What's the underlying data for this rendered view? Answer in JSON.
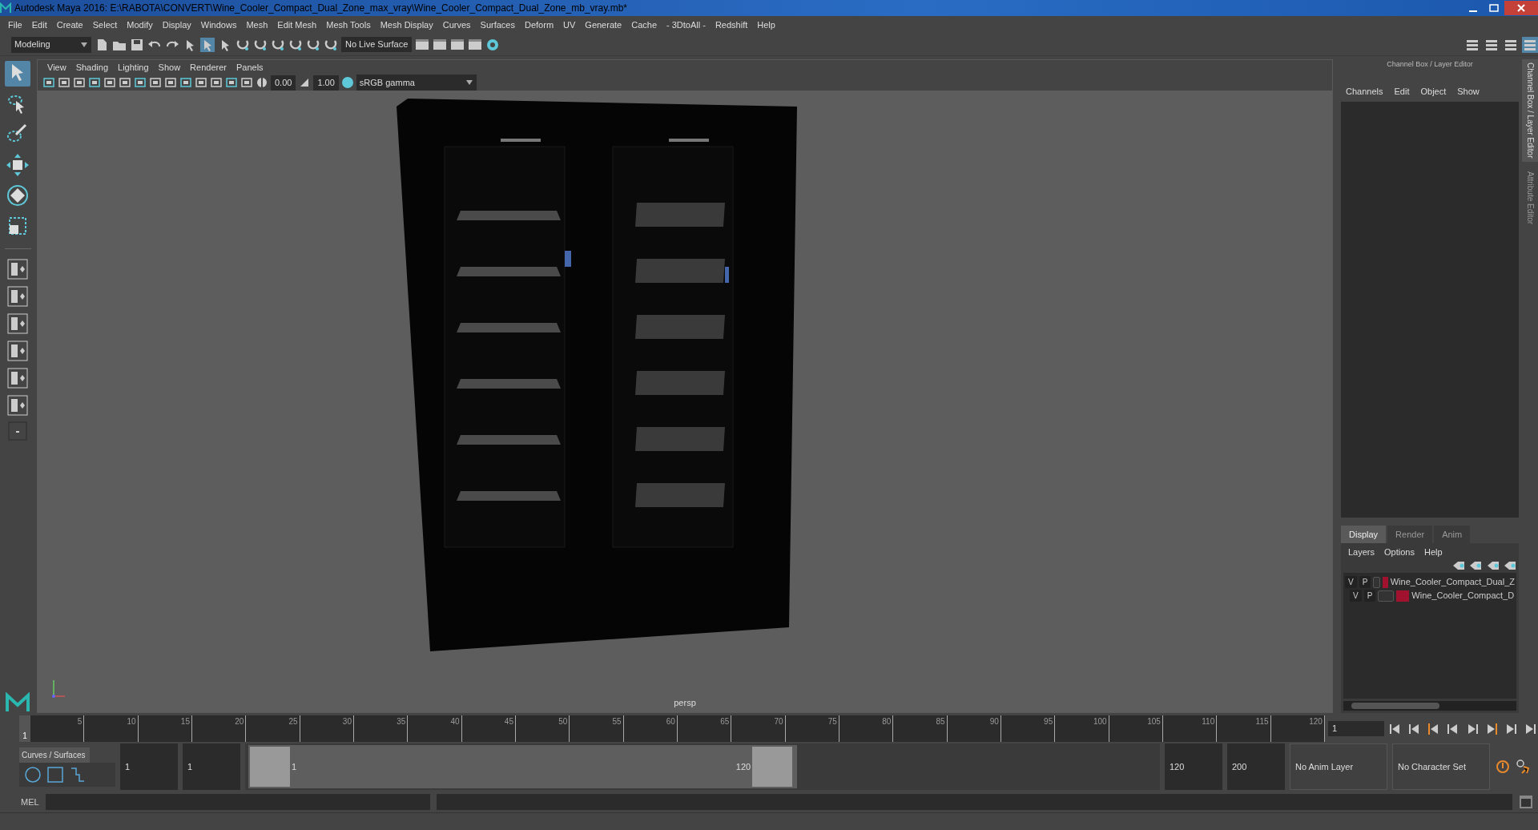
{
  "window": {
    "title": "Autodesk Maya 2016: E:\\RABOTA\\CONVERT\\Wine_Cooler_Compact_Dual_Zone_max_vray\\Wine_Cooler_Compact_Dual_Zone_mb_vray.mb*"
  },
  "menu_bar": [
    "File",
    "Edit",
    "Create",
    "Select",
    "Modify",
    "Display",
    "Windows",
    "Mesh",
    "Edit Mesh",
    "Mesh Tools",
    "Mesh Display",
    "Curves",
    "Surfaces",
    "Deform",
    "UV",
    "Generate",
    "Cache",
    "- 3DtoAll -",
    "Redshift",
    "Help"
  ],
  "status_line": {
    "menu_set": "Modeling",
    "live_surface": "No Live Surface"
  },
  "toolbox": [
    {
      "kind": "select",
      "selected": true
    },
    {
      "kind": "lasso",
      "selected": false
    },
    {
      "kind": "paint",
      "selected": false
    },
    {
      "kind": "move",
      "selected": false
    },
    {
      "kind": "rotate",
      "selected": false
    },
    {
      "kind": "scale",
      "selected": false
    }
  ],
  "viewport": {
    "panel_menu": [
      "View",
      "Shading",
      "Lighting",
      "Show",
      "Renderer",
      "Panels"
    ],
    "exposure": "0.00",
    "gamma": "1.00",
    "color_space": "sRGB gamma",
    "camera": "persp"
  },
  "channel_box": {
    "title": "Channel Box / Layer Editor",
    "menus": [
      "Channels",
      "Edit",
      "Object",
      "Show"
    ]
  },
  "layer_editor": {
    "tabs": [
      {
        "label": "Display",
        "selected": true
      },
      {
        "label": "Render",
        "selected": false
      },
      {
        "label": "Anim",
        "selected": false
      }
    ],
    "menus": [
      "Layers",
      "Options",
      "Help"
    ],
    "layers": [
      {
        "visibility": "V",
        "playback": "P",
        "color": "#a0122e",
        "name": "Wine_Cooler_Compact_Dual_Z"
      },
      {
        "visibility": "V",
        "playback": "P",
        "color": "#a0122e",
        "name": "Wine_Cooler_Compact_D"
      }
    ]
  },
  "side_tabs": [
    "Channel Box / Layer Editor",
    "Attribute Editor"
  ],
  "time_slider": {
    "current_frame_marker": "1",
    "level": 0,
    "ticks": [
      "5",
      "10",
      "15",
      "20",
      "25",
      "30",
      "35",
      "40",
      "45",
      "50",
      "55",
      "60",
      "65",
      "70",
      "75",
      "80",
      "85",
      "90",
      "95",
      "100",
      "105",
      "110",
      "115",
      "120"
    ],
    "current_frame": "1"
  },
  "shelf": {
    "tab": "Curves / Surfaces"
  },
  "range_slider": {
    "level": 0.6,
    "start": "1",
    "playback_start": "1",
    "range_start": "1",
    "range_end": "120",
    "playback_end": "120",
    "end": "200",
    "anim_layer": "No Anim Layer",
    "character_set": "No Character Set"
  },
  "command_line": {
    "label": "MEL"
  }
}
